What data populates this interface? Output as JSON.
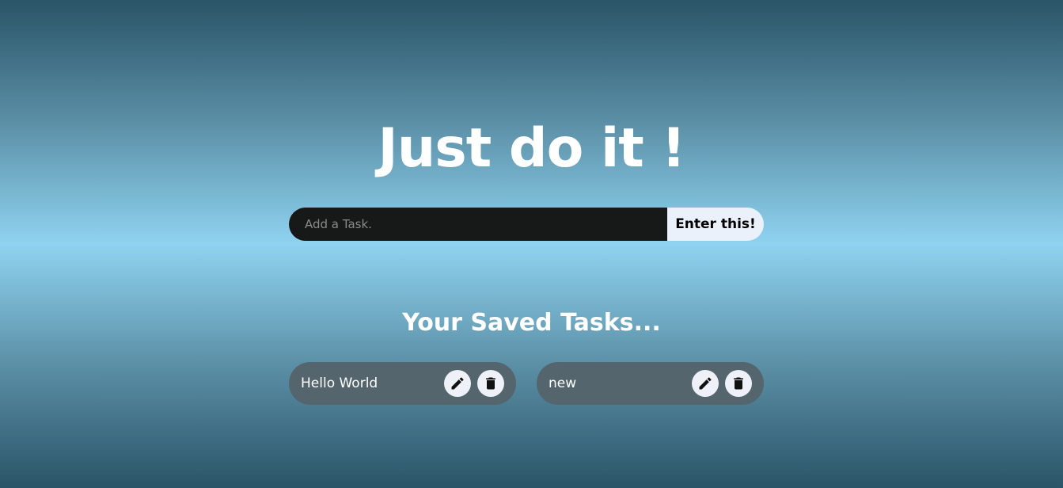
{
  "header": {
    "title": "Just do it !"
  },
  "task_form": {
    "input_value": "",
    "input_placeholder": "Add a Task.",
    "submit_label": "Enter this!"
  },
  "saved_section": {
    "heading": "Your Saved Tasks...",
    "tasks": [
      {
        "text": "Hello World",
        "edit_icon": "pencil-icon",
        "delete_icon": "trash-icon"
      },
      {
        "text": "new",
        "edit_icon": "pencil-icon",
        "delete_icon": "trash-icon"
      }
    ]
  },
  "colors": {
    "background_top": "#2a5468",
    "background_middle": "#8fd3f0",
    "input_background": "#171818",
    "button_background": "#eaf1fb",
    "card_background": "#55656e"
  }
}
